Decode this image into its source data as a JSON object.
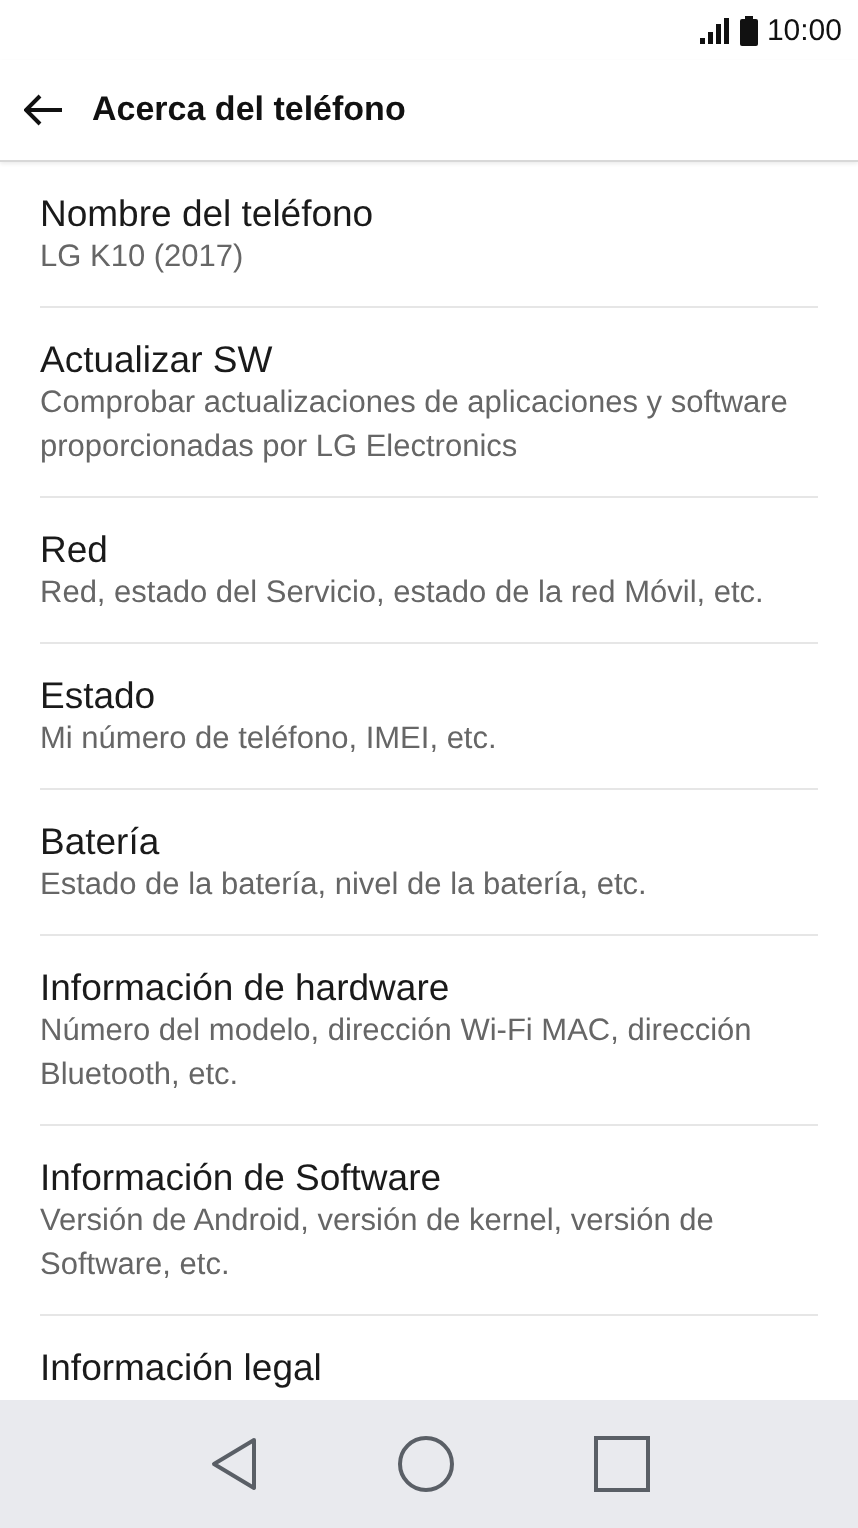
{
  "status_bar": {
    "time": "10:00"
  },
  "app_bar": {
    "title": "Acerca del teléfono"
  },
  "items": [
    {
      "title": "Nombre del teléfono",
      "subtitle": "LG K10 (2017)"
    },
    {
      "title": "Actualizar SW",
      "subtitle": "Comprobar actualizaciones de aplicaciones y software proporcionadas por LG Electronics"
    },
    {
      "title": "Red",
      "subtitle": "Red, estado del Servicio, estado de la red Móvil, etc."
    },
    {
      "title": "Estado",
      "subtitle": "Mi número de teléfono, IMEI, etc."
    },
    {
      "title": "Batería",
      "subtitle": "Estado de la batería, nivel de la batería, etc."
    },
    {
      "title": "Información de hardware",
      "subtitle": "Número del modelo, dirección Wi-Fi MAC, dirección Bluetooth, etc."
    },
    {
      "title": "Información de Software",
      "subtitle": "Versión de Android, versión de kernel, versión de Software, etc."
    },
    {
      "title": "Información legal"
    }
  ]
}
